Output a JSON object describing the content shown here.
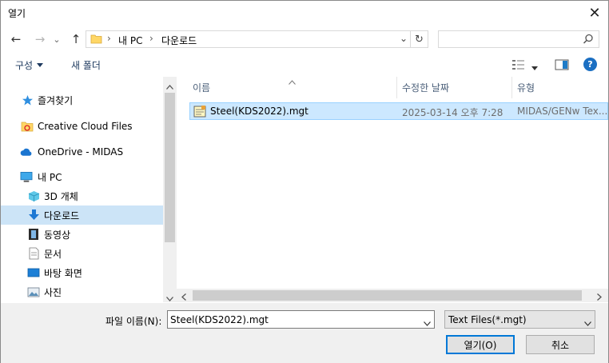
{
  "window": {
    "title": "열기",
    "close_glyph": "✕"
  },
  "nav": {
    "back_glyph": "←",
    "forward_glyph": "→",
    "recent_glyph": "⌄",
    "up_glyph": "↑"
  },
  "address": {
    "sep1": "›",
    "crumb1": "내 PC",
    "sep2": "›",
    "crumb2": "다운로드",
    "dropdown_glyph": "⌄",
    "refresh_glyph": "↻"
  },
  "search": {
    "placeholder": ""
  },
  "toolbar": {
    "organize": "구성",
    "new_folder": "새 폴더",
    "help": "?"
  },
  "sidebar": {
    "items": [
      {
        "label": "즐겨찾기"
      },
      {
        "label": "Creative Cloud Files"
      },
      {
        "label": "OneDrive - MIDAS"
      },
      {
        "label": "내 PC"
      },
      {
        "label": "3D 개체"
      },
      {
        "label": "다운로드"
      },
      {
        "label": "동영상"
      },
      {
        "label": "문서"
      },
      {
        "label": "바탕 화면"
      },
      {
        "label": "사진"
      }
    ]
  },
  "columns": {
    "name": "이름",
    "date": "수정한 날짜",
    "type": "유형"
  },
  "files": [
    {
      "name": "Steel(KDS2022).mgt",
      "date": "2025-03-14 오후 7:28",
      "type": "MIDAS/GENw Tex..."
    }
  ],
  "footer": {
    "filename_label": "파일 이름(N):",
    "filename_value": "Steel(KDS2022).mgt",
    "filter_value": "Text Files(*.mgt)",
    "open_label": "열기(O)",
    "cancel_label": "취소"
  },
  "colors": {
    "selected_bg": "#cce4f7",
    "file_selected_bg": "#cce8ff",
    "accent": "#0078d7"
  }
}
